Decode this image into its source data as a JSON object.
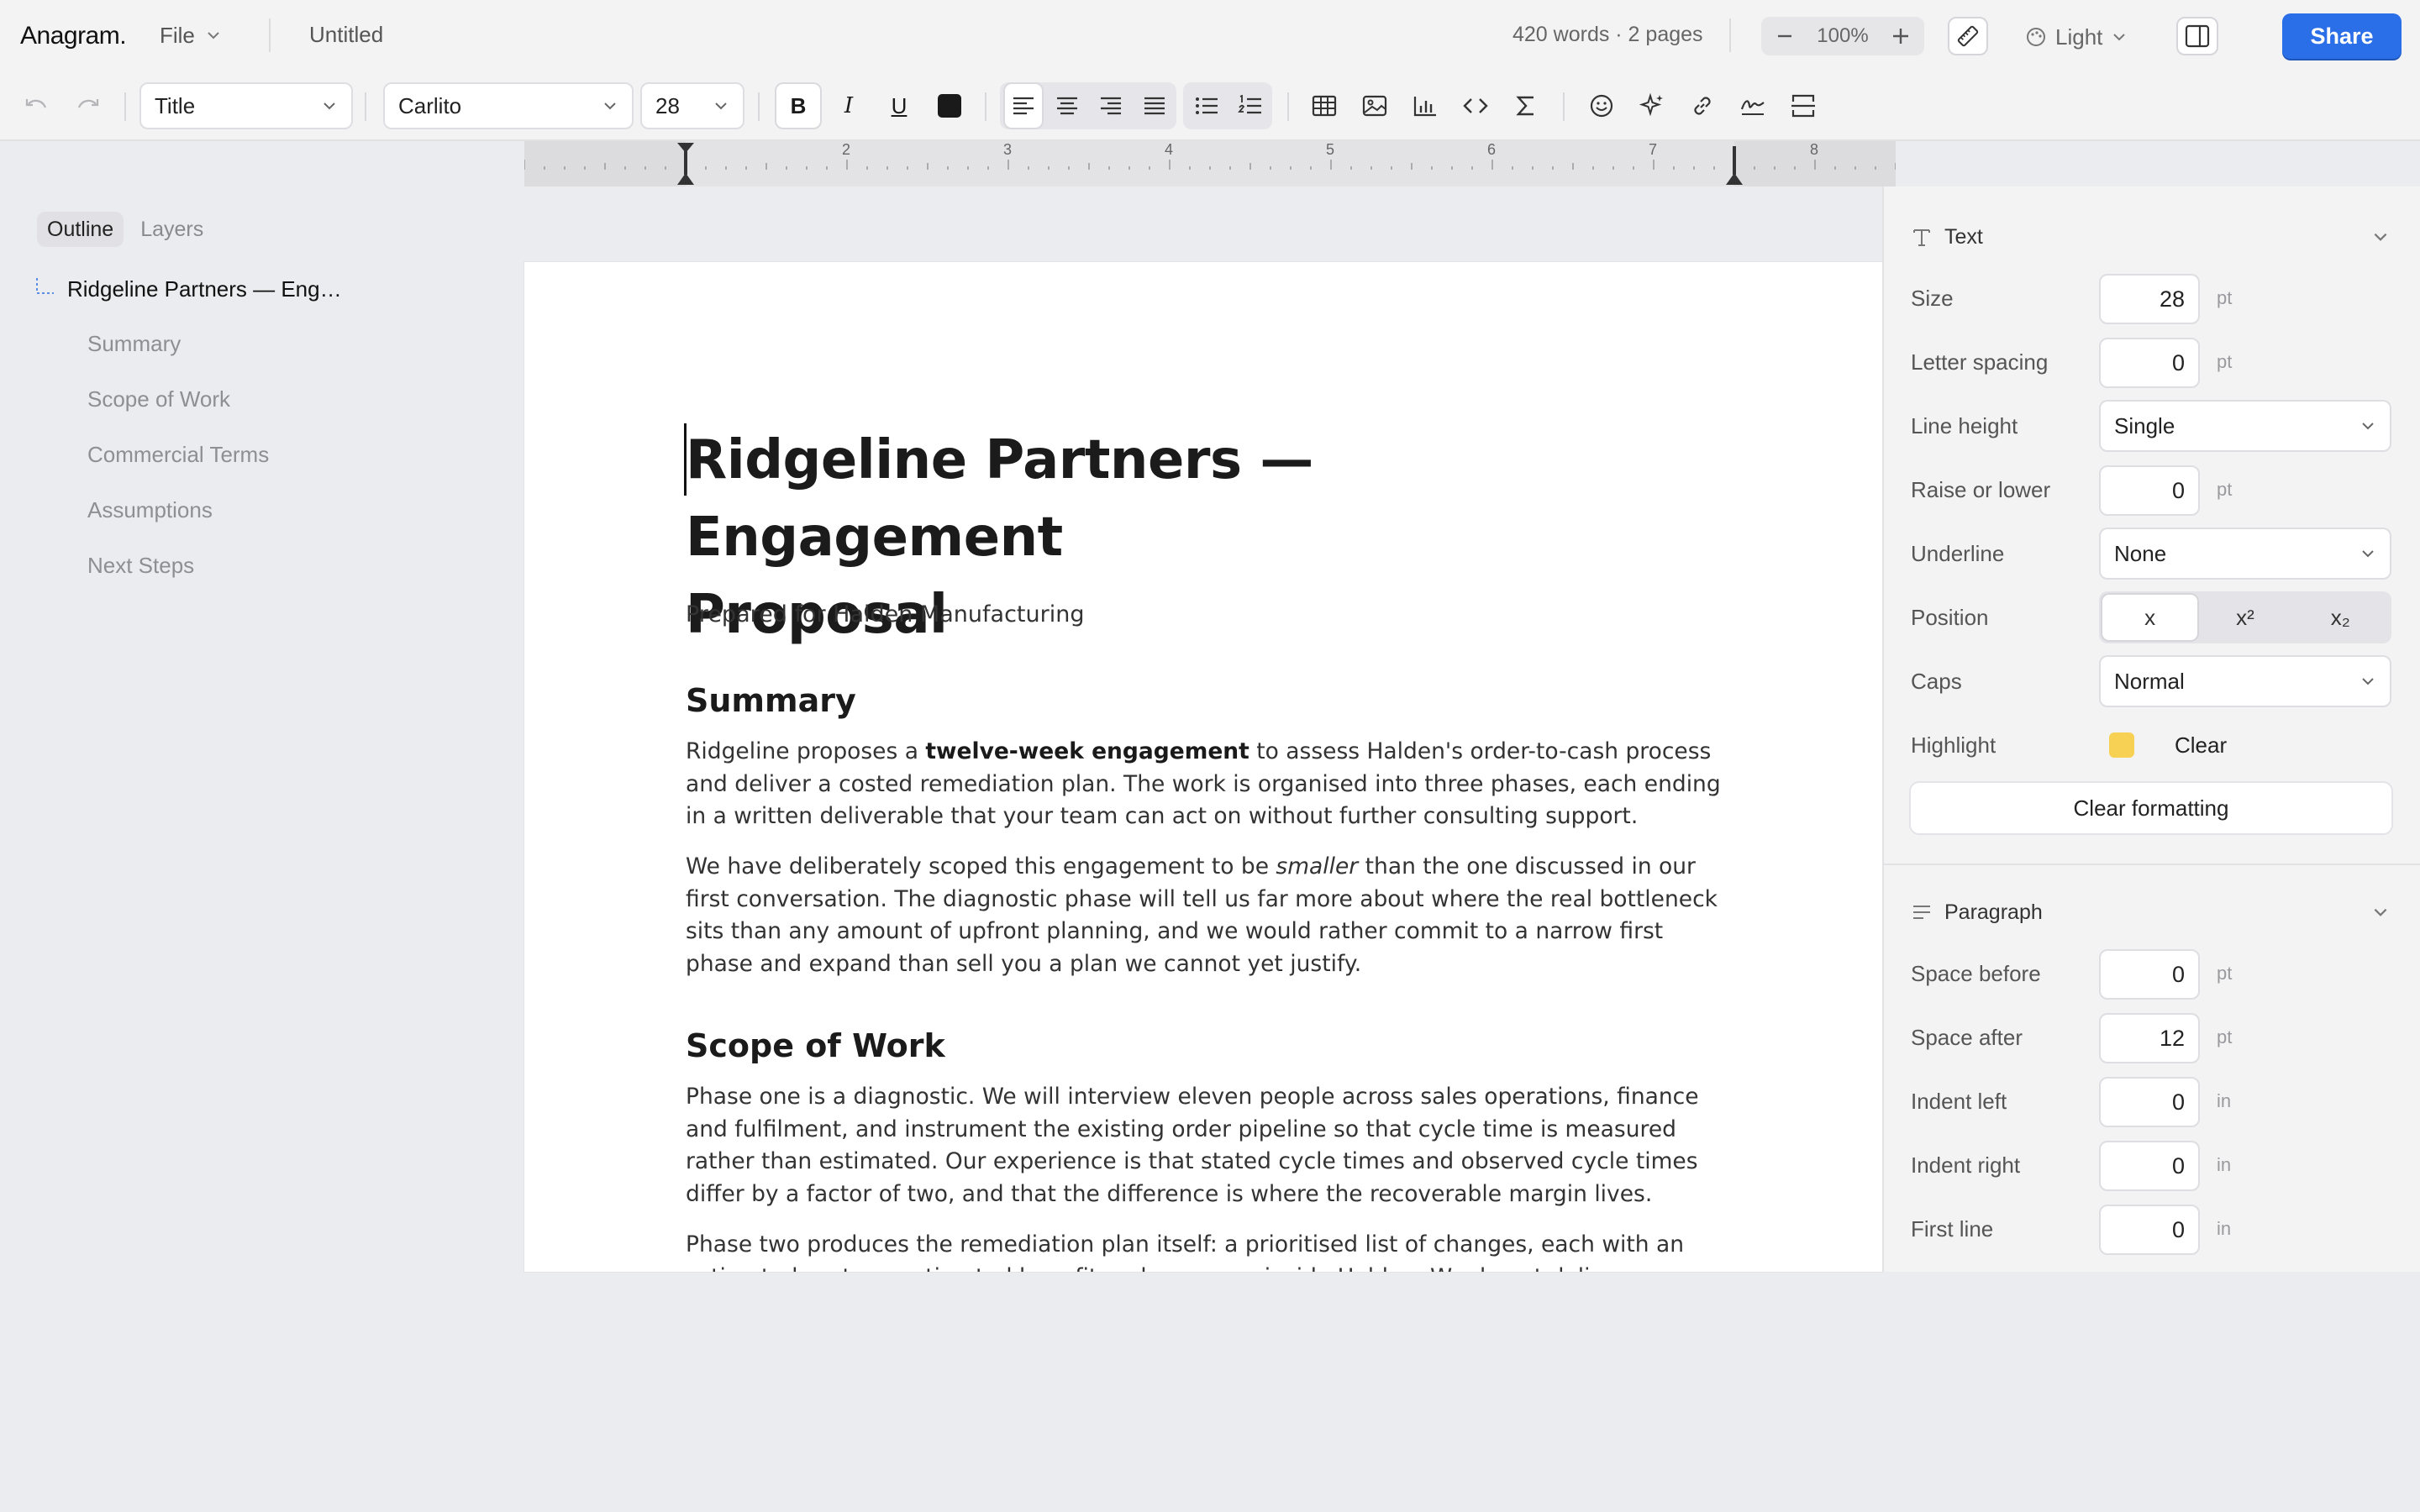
{
  "app": {
    "brand": "Anagram.",
    "file_menu": "File",
    "doc_title": "Untitled",
    "word_count": "420 words · 2 pages"
  },
  "zoom": {
    "value": "100%"
  },
  "theme": {
    "label": "Light"
  },
  "share": {
    "label": "Share"
  },
  "toolbar": {
    "style_select": "Title",
    "font_select": "Carlito",
    "size_select": "28",
    "text_color": "#1a1a1a",
    "icons": [
      "undo-icon",
      "redo-icon",
      "bold-icon",
      "italic-icon",
      "underline-icon",
      "text-color-swatch",
      "align-left-icon",
      "align-center-icon",
      "align-right-icon",
      "align-justify-icon",
      "bullet-list-icon",
      "numbered-list-icon",
      "table-icon",
      "image-icon",
      "chart-icon",
      "code-icon",
      "sigma-icon",
      "emoji-icon",
      "sparkle-icon",
      "link-icon",
      "signature-icon",
      "page-break-icon"
    ],
    "bold_label": "B",
    "italic_label": "I",
    "underline_label": "U"
  },
  "ruler": {
    "numbers": [
      "2",
      "3",
      "4",
      "5",
      "6",
      "7",
      "8"
    ]
  },
  "sidebar": {
    "tabs": [
      {
        "label": "Outline",
        "active": true
      },
      {
        "label": "Layers",
        "active": false
      }
    ],
    "root": "Ridgeline Partners — Eng…",
    "items": [
      "Summary",
      "Scope of Work",
      "Commercial Terms",
      "Assumptions",
      "Next Steps"
    ]
  },
  "document": {
    "title_line1": "Ridgeline Partners — Engagement",
    "title_line2": "Proposal",
    "subtitle": "Prepared for Halden Manufacturing",
    "summary_heading": "Summary",
    "summary_p1_a": "Ridgeline proposes a ",
    "summary_p1_bold": "twelve-week engagement",
    "summary_p1_b": " to assess Halden's order-to-cash process and deliver a costed remediation plan. The work is organised into three phases, each ending in a written deliverable that your team can act on without further consulting support.",
    "summary_p2_a": "We have deliberately scoped this engagement to be ",
    "summary_p2_italic": "smaller",
    "summary_p2_b": " than the one discussed in our first conversation. The diagnostic phase will tell us far more about where the real bottleneck sits than any amount of upfront planning, and we would rather commit to a narrow first phase and expand than sell you a plan we cannot yet justify.",
    "scope_heading": "Scope of Work",
    "scope_p1": "Phase one is a diagnostic. We will interview eleven people across sales operations, finance and fulfilment, and instrument the existing order pipeline so that cycle time is measured rather than estimated. Our experience is that stated cycle times and observed cycle times differ by a factor of two, and that the difference is where the recoverable margin lives.",
    "scope_p2": "Phase two produces the remediation plan itself: a prioritised list of changes, each with an estimated cost, an estimated benefit and an owner inside Halden. We do not deliver recommendations without"
  },
  "inspector": {
    "text_section": "Text",
    "size_label": "Size",
    "size_value": "28",
    "size_unit": "pt",
    "letter_label": "Letter spacing",
    "letter_value": "0",
    "letter_unit": "pt",
    "lineheight_label": "Line height",
    "lineheight_value": "Single",
    "raise_label": "Raise or lower",
    "raise_value": "0",
    "raise_unit": "pt",
    "underline_label": "Underline",
    "underline_value": "None",
    "position_label": "Position",
    "position_opts": [
      "x",
      "x²",
      "x₂"
    ],
    "caps_label": "Caps",
    "caps_value": "Normal",
    "highlight_label": "Highlight",
    "highlight_color": "#f7d154",
    "highlight_clear": "Clear",
    "clear_formatting": "Clear formatting",
    "para_section": "Paragraph",
    "space_before_label": "Space before",
    "space_before_value": "0",
    "space_before_unit": "pt",
    "space_after_label": "Space after",
    "space_after_value": "12",
    "space_after_unit": "pt",
    "indent_left_label": "Indent left",
    "indent_left_value": "0",
    "indent_left_unit": "in",
    "indent_right_label": "Indent right",
    "indent_right_value": "0",
    "indent_right_unit": "in",
    "first_line_label": "First line",
    "first_line_value": "0",
    "first_line_unit": "in"
  },
  "colors": {
    "accent": "#2a6ee8",
    "highlight": "#f7d154"
  }
}
